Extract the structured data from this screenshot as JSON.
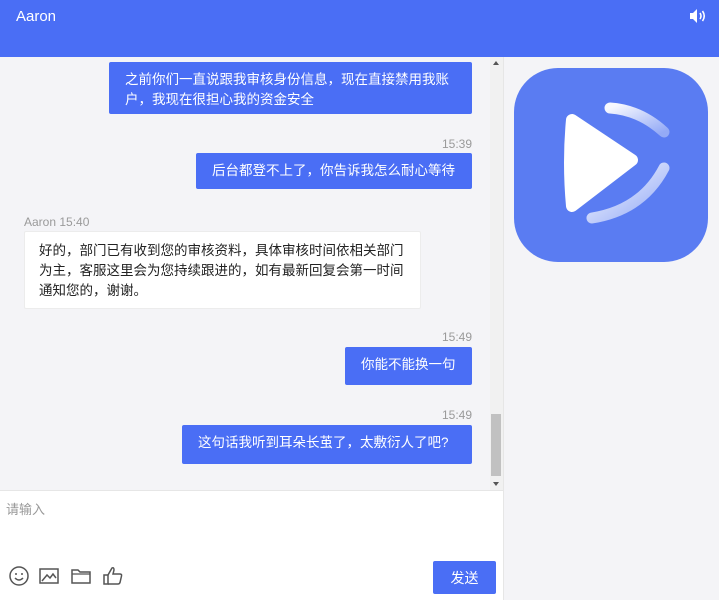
{
  "header": {
    "title": "Aaron"
  },
  "messages": [
    {
      "type": "outgoing",
      "text": "之前你们一直说跟我审核身份信息，现在直接禁用我账户，我现在很担心我的资金安全"
    },
    {
      "type": "outgoing",
      "time": "15:39",
      "text": "后台都登不上了，你告诉我怎么耐心等待"
    },
    {
      "type": "incoming",
      "meta": "Aaron 15:40",
      "text": "好的，部门已有收到您的审核资料，具体审核时间依相关部门为主，客服这里会为您持续跟进的，如有最新回复会第一时间通知您的，谢谢。"
    },
    {
      "type": "outgoing",
      "time": "15:49",
      "text": "你能不能换一句"
    },
    {
      "type": "outgoing",
      "time": "15:49",
      "text": "这句话我听到耳朵长茧了，太敷衍人了吧?"
    }
  ],
  "input": {
    "placeholder": "请输入"
  },
  "toolbar": {
    "icons": [
      "emoji-icon",
      "image-icon",
      "folder-icon",
      "thumbs-up-icon"
    ],
    "send_label": "发送"
  },
  "colors": {
    "accent": "#4a6ef5",
    "chat_bg": "#f4f4f7"
  }
}
